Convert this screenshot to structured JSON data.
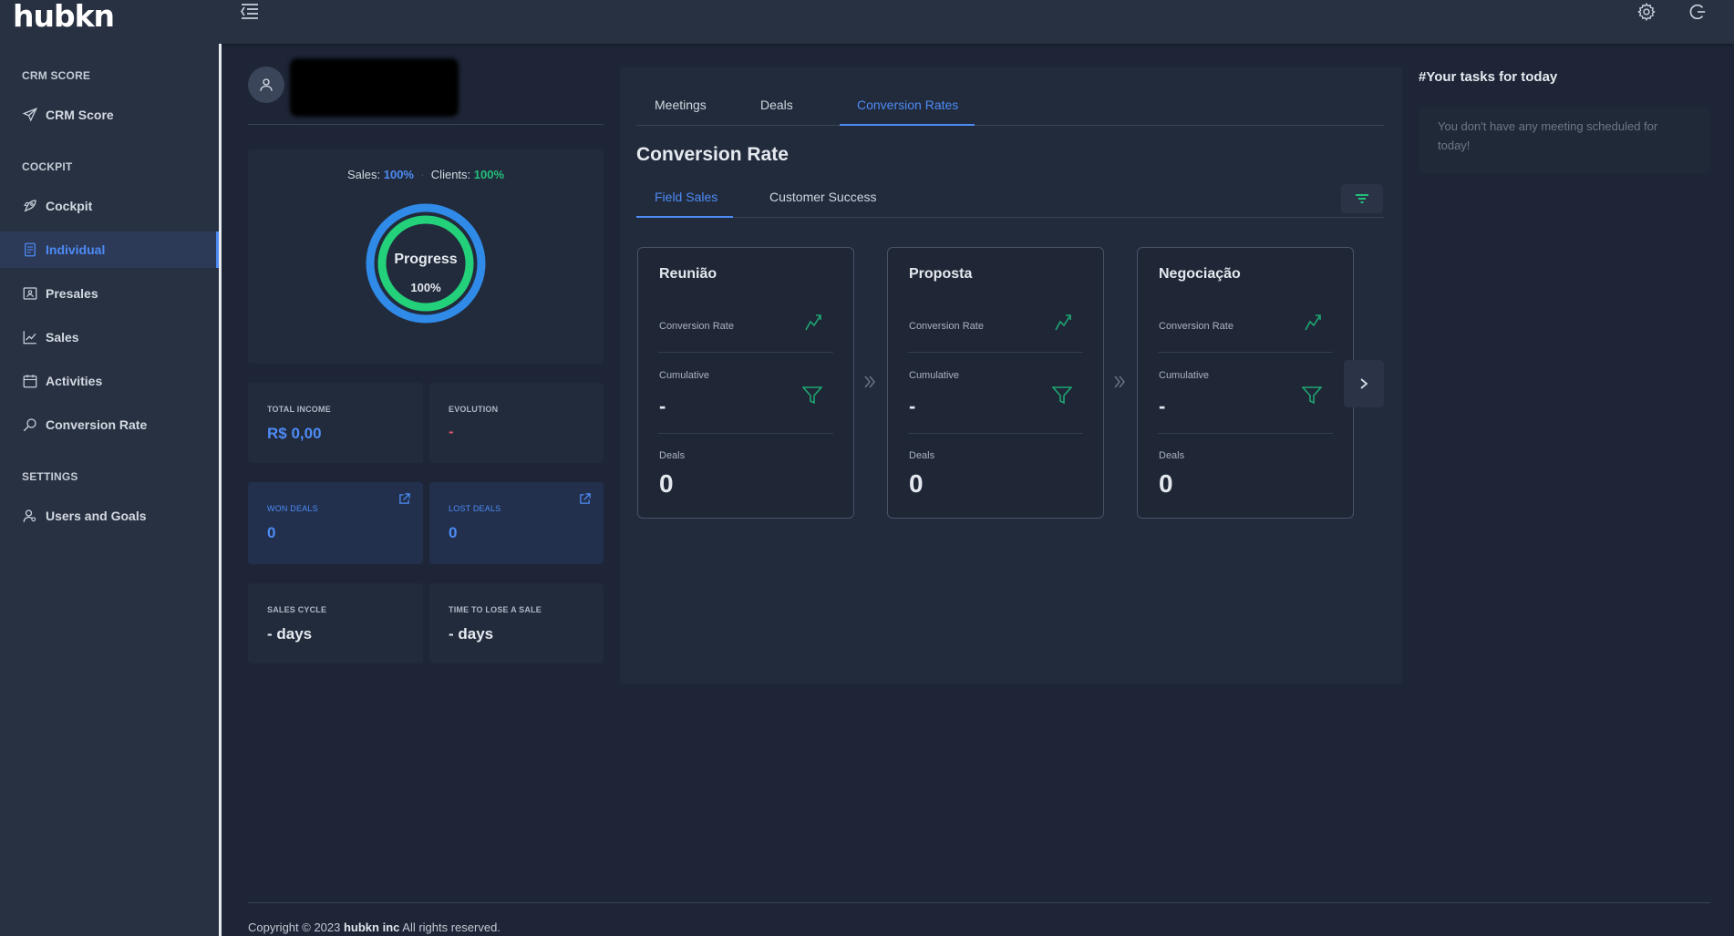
{
  "app": {
    "logo": "hubkn"
  },
  "sidebar": {
    "sections": [
      "CRM SCORE",
      "COCKPIT",
      "SETTINGS"
    ],
    "items": [
      {
        "label": "CRM Score",
        "icon": "send-icon"
      },
      {
        "label": "Cockpit",
        "icon": "rocket-icon"
      },
      {
        "label": "Individual",
        "icon": "document-icon",
        "active": true
      },
      {
        "label": "Presales",
        "icon": "presentation-icon"
      },
      {
        "label": "Sales",
        "icon": "line-chart-icon"
      },
      {
        "label": "Activities",
        "icon": "calendar-icon"
      },
      {
        "label": "Conversion Rate",
        "icon": "search-icon"
      },
      {
        "label": "Users and Goals",
        "icon": "users-icon"
      }
    ]
  },
  "profile": {
    "progress_header": {
      "sales_label": "Sales:",
      "sales_value": "100%",
      "clients_label": "Clients:",
      "clients_value": "100%"
    },
    "progress_ring": {
      "label": "Progress",
      "value": "100%",
      "fraction": 1.0
    },
    "stats": {
      "total_income": {
        "label": "TOTAL INCOME",
        "value": "R$ 0,00"
      },
      "evolution": {
        "label": "EVOLUTION",
        "value": "-"
      },
      "won_deals": {
        "label": "WON DEALS",
        "value": "0"
      },
      "lost_deals": {
        "label": "LOST DEALS",
        "value": "0"
      },
      "sales_cycle": {
        "label": "SALES CYCLE",
        "value": "- days"
      },
      "time_to_lose": {
        "label": "TIME TO LOSE A SALE",
        "value": "- days"
      }
    }
  },
  "main": {
    "tabs": [
      "Meetings",
      "Deals",
      "Conversion Rates"
    ],
    "active_tab": "Conversion Rates",
    "title": "Conversion Rate",
    "subtabs": [
      "Field Sales",
      "Customer Success"
    ],
    "active_subtab": "Field Sales",
    "labels": {
      "conversion_rate": "Conversion Rate",
      "cumulative": "Cumulative",
      "deals": "Deals"
    },
    "stages": [
      {
        "name": "Reunião",
        "cumulative": "-",
        "deals": "0"
      },
      {
        "name": "Proposta",
        "cumulative": "-",
        "deals": "0"
      },
      {
        "name": "Negociação",
        "cumulative": "-",
        "deals": "0"
      }
    ]
  },
  "tasks": {
    "title": "#Your tasks for today",
    "empty_message": "You don't have any meeting scheduled for today!"
  },
  "footer": {
    "prefix": "Copyright © 2023 ",
    "company": "hubkn inc",
    "suffix": " All rights reserved."
  },
  "colors": {
    "accent_blue": "#4d8bf5",
    "accent_green": "#22c07a",
    "negative_red": "#e0566a"
  }
}
